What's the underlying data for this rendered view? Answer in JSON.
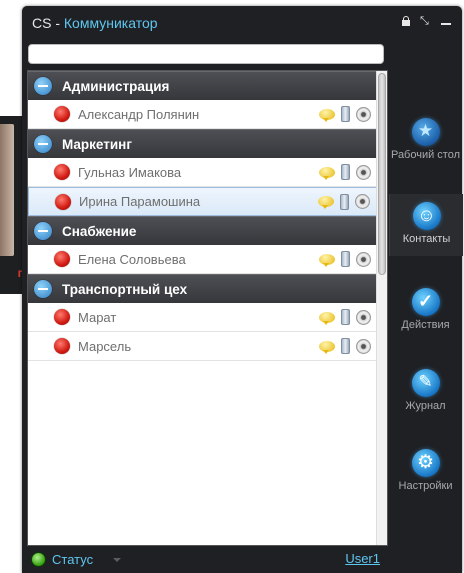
{
  "background_window": {
    "partial_text": "ги"
  },
  "title": {
    "prefix": "CS - ",
    "app": "Коммуникатор"
  },
  "search": {
    "value": ""
  },
  "groups": [
    {
      "name": "Администрация",
      "contacts": [
        "Александр Полянин"
      ]
    },
    {
      "name": "Маркетинг",
      "contacts": [
        "Гульназ Имакова",
        "Ирина Парамошина"
      ]
    },
    {
      "name": "Снабжение",
      "contacts": [
        "Елена Соловьева"
      ]
    },
    {
      "name": "Транспортный цех",
      "contacts": [
        "Марат",
        "Марсель"
      ]
    }
  ],
  "sidebar": {
    "items": [
      {
        "label": "Рабочий стол",
        "icon": "star-icon"
      },
      {
        "label": "Контакты",
        "icon": "person-icon"
      },
      {
        "label": "Действия",
        "icon": "check-icon"
      },
      {
        "label": "Журнал",
        "icon": "pen-icon"
      },
      {
        "label": "Настройки",
        "icon": "cog-icon"
      }
    ]
  },
  "statusbar": {
    "status": "Статус",
    "user": "User1"
  },
  "colors": {
    "accent": "#5ec7f0",
    "offline": "#d11a12",
    "online": "#3aa315",
    "window": "#1f2023"
  }
}
